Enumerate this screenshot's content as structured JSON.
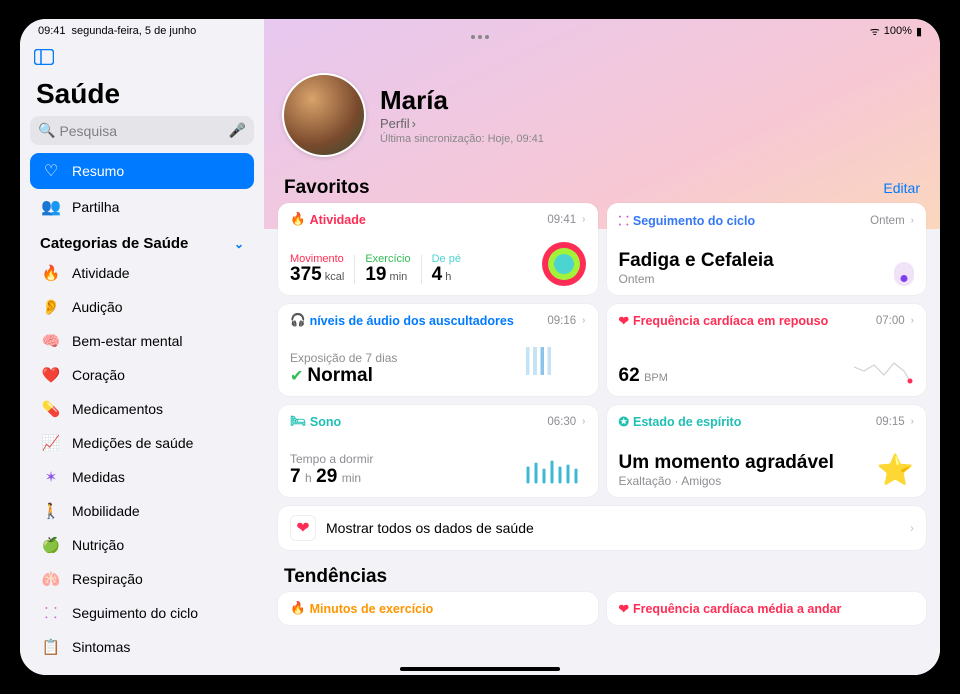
{
  "statusbar": {
    "time": "09:41",
    "date": "segunda-feira, 5 de junho",
    "wifi": "􀙇",
    "battery": "100%"
  },
  "sidebar": {
    "title": "Saúde",
    "search_placeholder": "Pesquisa",
    "nav": [
      {
        "label": "Resumo",
        "icon": "♡"
      },
      {
        "label": "Partilha",
        "icon": "👥"
      }
    ],
    "section": "Categorias de Saúde",
    "categories": [
      {
        "label": "Atividade",
        "icon": "🔥",
        "color": "#ff2d55"
      },
      {
        "label": "Audição",
        "icon": "👂",
        "color": "#3da2ff"
      },
      {
        "label": "Bem-estar mental",
        "icon": "🧠",
        "color": "#1fd3bf"
      },
      {
        "label": "Coração",
        "icon": "❤️",
        "color": "#ff2d55"
      },
      {
        "label": "Medicamentos",
        "icon": "💊",
        "color": "#4aa8ff"
      },
      {
        "label": "Medições de saúde",
        "icon": "📈",
        "color": "#ff2d55"
      },
      {
        "label": "Medidas",
        "icon": "✶",
        "color": "#8e5ce6"
      },
      {
        "label": "Mobilidade",
        "icon": "🚶",
        "color": "#ff9500"
      },
      {
        "label": "Nutrição",
        "icon": "🍏",
        "color": "#30bd54"
      },
      {
        "label": "Respiração",
        "icon": "🫁",
        "color": "#3db6d6"
      },
      {
        "label": "Seguimento do ciclo",
        "icon": "⸬",
        "color": "#d45bd0"
      },
      {
        "label": "Sintomas",
        "icon": "📋",
        "color": "#6e5bcc"
      }
    ]
  },
  "profile": {
    "name": "María",
    "link": "Perfil",
    "sync": "Última sincronização: Hoje, 09:41"
  },
  "favorites": {
    "title": "Favoritos",
    "edit": "Editar",
    "cards": {
      "activity": {
        "title": "Atividade",
        "time": "09:41",
        "move_label": "Movimento",
        "move_val": "375",
        "move_unit": "kcal",
        "ex_label": "Exercício",
        "ex_val": "19",
        "ex_unit": "min",
        "stand_label": "De pé",
        "stand_val": "4",
        "stand_unit": "h"
      },
      "cycle": {
        "title": "Seguimento do ciclo",
        "time": "Ontem",
        "big": "Fadiga e Cefaleia",
        "sub": "Ontem"
      },
      "audio": {
        "title": "níveis de áudio dos auscultadores",
        "time": "09:16",
        "sub": "Exposição de 7 dias",
        "big": "Normal"
      },
      "heart": {
        "title": "Frequência cardíaca em repouso",
        "time": "07:00",
        "val": "62",
        "unit": "BPM"
      },
      "sleep": {
        "title": "Sono",
        "time": "06:30",
        "sub": "Tempo a dormir",
        "h": "7",
        "hu": "h",
        "m": "29",
        "mu": "min"
      },
      "mood": {
        "title": "Estado de espírito",
        "time": "09:15",
        "big": "Um momento agradável",
        "sub": "Exaltação · Amigos"
      }
    },
    "show_all": "Mostrar todos os dados de saúde"
  },
  "trends": {
    "title": "Tendências",
    "cards": [
      {
        "title": "Minutos de exercício"
      },
      {
        "title": "Frequência cardíaca média a andar"
      }
    ]
  }
}
